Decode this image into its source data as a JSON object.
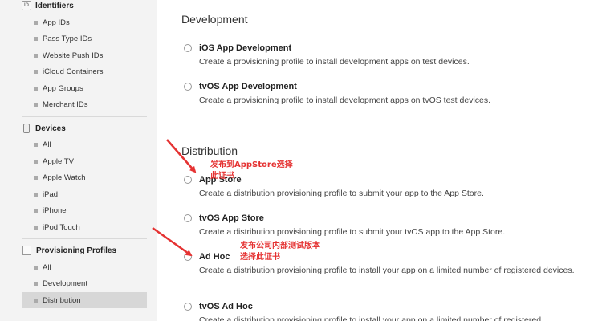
{
  "sidebar": {
    "identifiers": {
      "icon_text": "ID",
      "title": "Identifiers",
      "items": [
        "App IDs",
        "Pass Type IDs",
        "Website Push IDs",
        "iCloud Containers",
        "App Groups",
        "Merchant IDs"
      ]
    },
    "devices": {
      "title": "Devices",
      "items": [
        "All",
        "Apple TV",
        "Apple Watch",
        "iPad",
        "iPhone",
        "iPod Touch"
      ]
    },
    "profiles": {
      "title": "Provisioning Profiles",
      "items": [
        "All",
        "Development",
        "Distribution"
      ],
      "selected": "Distribution"
    }
  },
  "main": {
    "development": {
      "title": "Development",
      "options": [
        {
          "title": "iOS App Development",
          "desc": "Create a provisioning profile to install development apps on test devices."
        },
        {
          "title": "tvOS App Development",
          "desc": "Create a provisioning profile to install development apps on tvOS test devices."
        }
      ]
    },
    "distribution": {
      "title": "Distribution",
      "options": [
        {
          "title": "App Store",
          "desc": "Create a distribution provisioning profile to submit your app to the App Store."
        },
        {
          "title": "tvOS App Store",
          "desc": "Create a distribution provisioning profile to submit your tvOS app to the App Store."
        },
        {
          "title": "Ad Hoc",
          "desc": "Create a distribution provisioning profile to install your app on a limited number of registered devices."
        },
        {
          "title": "tvOS Ad Hoc",
          "desc": "Create a distribution provisioning profile to install your app on a limited number of registered"
        }
      ]
    }
  },
  "annotations": {
    "appstore_line1": "发布到AppStore选择",
    "appstore_line2": "此证书",
    "adhoc_line1": "发布公司内部测试版本",
    "adhoc_line2": "选择此证书",
    "color": "#e53232"
  }
}
